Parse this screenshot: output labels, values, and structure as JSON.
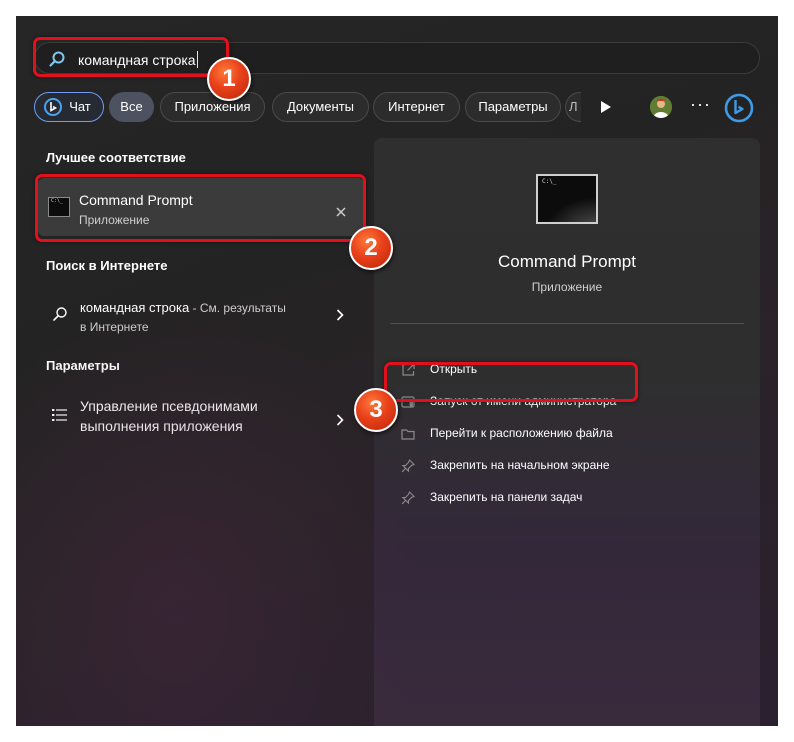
{
  "search": {
    "query": "командная строка"
  },
  "filters": {
    "chat": "Чат",
    "all": "Все",
    "apps": "Приложения",
    "documents": "Документы",
    "internet": "Интернет",
    "parameters": "Параметры",
    "more_partial": "Л"
  },
  "left": {
    "best_header": "Лучшее соответствие",
    "best_match": {
      "title": "Command Prompt",
      "subtitle": "Приложение"
    },
    "web_header": "Поиск в Интернете",
    "web_result": {
      "query": "командная строка",
      "suffix": " - См. результаты",
      "line2": "в Интернете"
    },
    "params_header": "Параметры",
    "params_result": {
      "line1": "Управление псевдонимами",
      "line2": "выполнения приложения"
    }
  },
  "right": {
    "title": "Command Prompt",
    "subtitle": "Приложение",
    "actions": [
      {
        "label": "Открыть",
        "icon": "open-external-icon"
      },
      {
        "label": "Запуск от имени администратора",
        "icon": "shield-admin-icon"
      },
      {
        "label": "Перейти к расположению файла",
        "icon": "folder-icon"
      },
      {
        "label": "Закрепить на начальном экране",
        "icon": "pin-icon"
      },
      {
        "label": "Закрепить на панели задач",
        "icon": "pin-icon"
      }
    ]
  },
  "annotations": {
    "badge1": "1",
    "badge2": "2",
    "badge3": "3"
  },
  "colors": {
    "highlight": "#e0101c",
    "badge": "#e8401a",
    "accent": "#6f9cf2",
    "panel": "#2f2f2f"
  }
}
